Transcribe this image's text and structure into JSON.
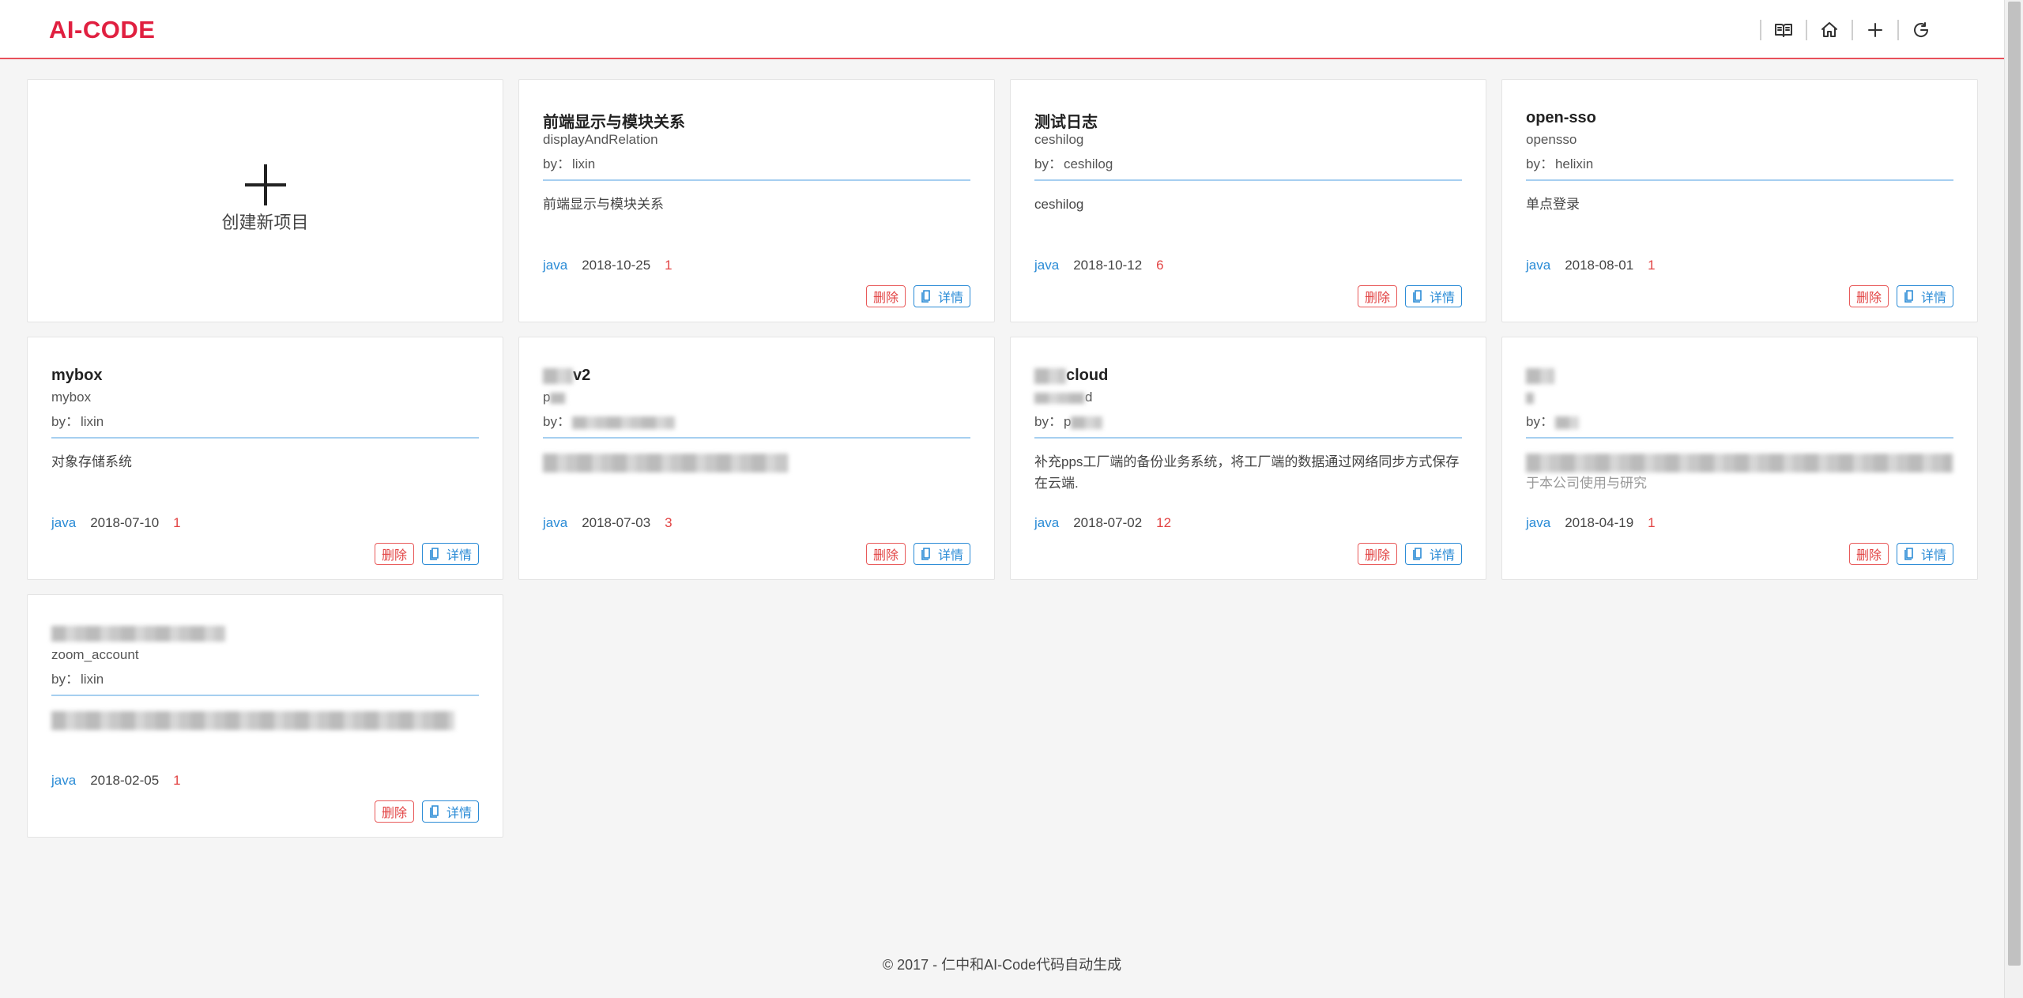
{
  "header": {
    "logo": "AI-CODE",
    "nav_icons": [
      "book-icon",
      "home-icon",
      "plus-icon",
      "refresh-icon"
    ]
  },
  "new_project": {
    "label": "创建新项目"
  },
  "labels": {
    "by": "by：",
    "delete": "删除",
    "detail": "详情"
  },
  "projects": [
    {
      "title": "前端显示与模块关系",
      "code": "displayAndRelation",
      "author": "lixin",
      "desc": "前端显示与模块关系",
      "lang": "java",
      "date": "2018-10-25",
      "count": "1"
    },
    {
      "title": "测试日志",
      "code": "ceshilog",
      "author": "ceshilog",
      "desc": "ceshilog",
      "lang": "java",
      "date": "2018-10-12",
      "count": "6"
    },
    {
      "title": "open-sso",
      "code": "opensso",
      "author": "helixin",
      "desc": "单点登录",
      "lang": "java",
      "date": "2018-08-01",
      "count": "1"
    },
    {
      "title": "mybox",
      "code": "mybox",
      "author": "lixin",
      "desc": "对象存储系统",
      "lang": "java",
      "date": "2018-07-10",
      "count": "1"
    },
    {
      "title": "v2",
      "code": "p",
      "author": "",
      "desc": "",
      "lang": "java",
      "date": "2018-07-03",
      "count": "3"
    },
    {
      "title": "cloud",
      "code": "d",
      "author": "p",
      "desc": "补充pps工厂端的备份业务系统，将工厂端的数据通过网络同步方式保存在云端.",
      "lang": "java",
      "date": "2018-07-02",
      "count": "12"
    },
    {
      "title": "",
      "code": "",
      "author": "",
      "desc": "于本公司使用与研究",
      "lang": "java",
      "date": "2018-04-19",
      "count": "1"
    },
    {
      "title": "",
      "code": "zoom_account",
      "author": "lixin",
      "desc": "",
      "lang": "java",
      "date": "2018-02-05",
      "count": "1"
    }
  ],
  "footer": {
    "text": "© 2017 - 仁中和AI-Code代码自动生成"
  },
  "colors": {
    "brand": "#e02040",
    "accent": "#2a8bd6",
    "danger": "#e24444"
  }
}
